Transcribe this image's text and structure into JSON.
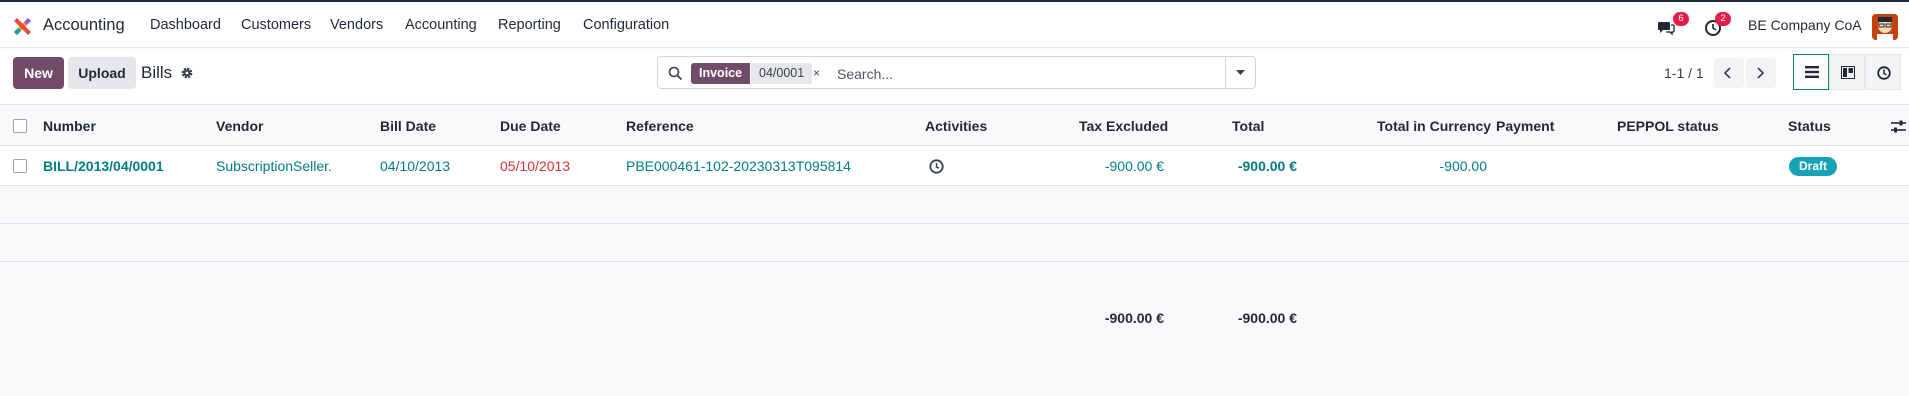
{
  "navbar": {
    "app_name": "Accounting",
    "menu": [
      "Dashboard",
      "Customers",
      "Vendors",
      "Accounting",
      "Reporting",
      "Configuration"
    ],
    "messages_count": "6",
    "activities_count": "2",
    "company": "BE Company CoA"
  },
  "control_panel": {
    "new_label": "New",
    "upload_label": "Upload",
    "breadcrumb_title": "Bills",
    "search": {
      "facet_label": "Invoice",
      "facet_value": "04/0001",
      "facet_remove": "×",
      "placeholder": "Search..."
    },
    "pager": "1-1 / 1"
  },
  "table": {
    "columns": [
      "Number",
      "Vendor",
      "Bill Date",
      "Due Date",
      "Reference",
      "Activities",
      "Tax Excluded",
      "Total",
      "Total in Currency",
      "Payment",
      "PEPPOL status",
      "Status"
    ],
    "rows": [
      {
        "number": "BILL/2013/04/0001",
        "vendor": "SubscriptionSeller.",
        "bill_date": "04/10/2013",
        "due_date": "05/10/2013",
        "reference": "PBE000461-102-20230313T095814",
        "tax_excluded": "-900.00 €",
        "total": "-900.00 €",
        "total_in_currency": "-900.00",
        "payment": "",
        "peppol_status": "",
        "status": "Draft"
      }
    ],
    "totals": {
      "tax_excluded": "-900.00 €",
      "total": "-900.00 €"
    }
  },
  "colors": {
    "brand": "#714b67",
    "link": "#017e84",
    "overdue": "#d63031",
    "draft_badge": "#17a2b8",
    "notification": "#e11d48"
  },
  "icons": [
    "app-logo-icon",
    "chat-icon",
    "clock-icon",
    "gear-icon",
    "search-icon",
    "caret-down-icon",
    "chevron-left-icon",
    "chevron-right-icon",
    "list-view-icon",
    "kanban-view-icon",
    "activity-view-icon",
    "optional-columns-icon"
  ]
}
